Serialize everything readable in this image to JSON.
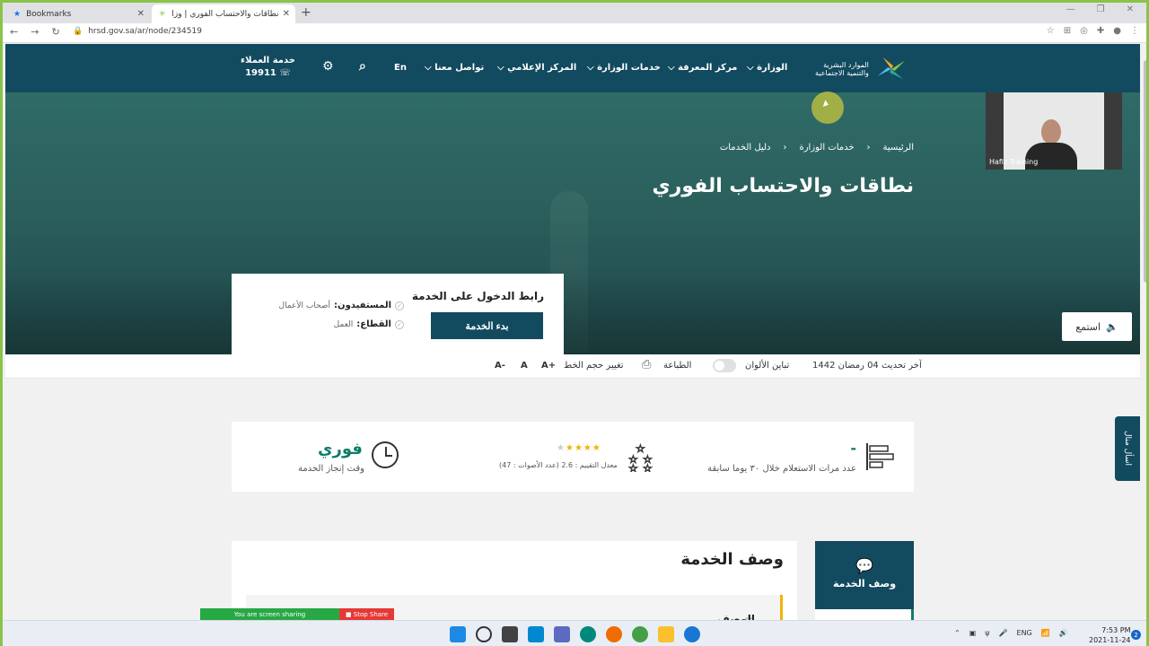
{
  "browser": {
    "tabs": [
      {
        "label": "Bookmarks"
      },
      {
        "label": "نطاقات والاحتساب الفوري | وزارة ا..."
      }
    ],
    "url": "hrsd.gov.sa/ar/node/234519"
  },
  "header": {
    "logo_line1": "الموارد البشرية",
    "logo_line2": "والتنمية الاجتماعية",
    "nav": [
      "الوزارة",
      "مركز المعرفة",
      "خدمات الوزارة",
      "المركز الإعلامي",
      "تواصل معنا"
    ],
    "lang": "En",
    "customer_service_label": "خدمة العملاء",
    "customer_service_number": "19911"
  },
  "hero": {
    "breadcrumb": [
      "الرئيسية",
      "خدمات الوزارة",
      "دليل الخدمات"
    ],
    "title": "نطاقات والاحتساب الفوري",
    "listen": "استمع"
  },
  "service_card": {
    "link_title": "رابط الدخول على الخدمة",
    "start_button": "بدء الخدمة",
    "beneficiaries_label": "المستفيدون:",
    "beneficiaries_value": "أصحاب الأعمال",
    "sector_label": "القطاع:",
    "sector_value": "العمل"
  },
  "toolbar": {
    "last_update": "آخر تحديث 04 رمضان 1442",
    "contrast": "تباين الألوان",
    "print": "الطباعة",
    "font_size": "تغيير حجم الخط",
    "font_plus": "A+",
    "font_normal": "A",
    "font_minus": "A-"
  },
  "stats": {
    "queries_value": "-",
    "queries_label": "عدد مرات الاستعلام خلال ٣٠ يوما سابقة",
    "rating_label": "معدل التقييم : 2.6 (عدد الأصوات : 47)",
    "rating_value": 2.6,
    "completion_value": "فوري",
    "completion_label": "وقت إنجاز الخدمة"
  },
  "description": {
    "side_label": "وصف الخدمة",
    "title": "وصف الخدمة",
    "sub": "الوصف"
  },
  "webcam": {
    "name": "Hafiz Training"
  },
  "feedback_tab": "اسأل منال",
  "screen_share": {
    "status": "You are screen sharing",
    "stop": "Stop Share"
  },
  "taskbar": {
    "time": "7:53 PM",
    "date": "2021-11-24",
    "lang": "ENG",
    "notifications": "2"
  },
  "colors": {
    "brand": "#124a5f",
    "accent": "#0f7c6b",
    "star": "#f0b400"
  }
}
